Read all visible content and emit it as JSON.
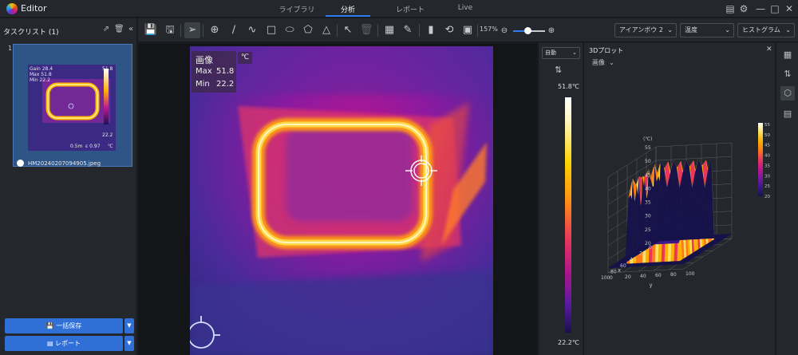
{
  "app": {
    "title": "Editor"
  },
  "nav": {
    "tabs": [
      {
        "label": "ライブラリ"
      },
      {
        "label": "分析"
      },
      {
        "label": "レポート"
      },
      {
        "label": "Live"
      }
    ],
    "active": "分析"
  },
  "tasklist": {
    "title": "タスクリスト (1)",
    "items": [
      {
        "index": "1",
        "filename": "HM20240207094905.jpeg",
        "thumb_gain": "Gain 28.4",
        "thumb_max": "Max 51.8",
        "thumb_min": "Min 22.2",
        "thumb_dist": "0.5m",
        "thumb_eps": "ε 0.97",
        "thumb_scale_max": "51.8",
        "thumb_scale_min": "22.2",
        "thumb_unit": "℃"
      }
    ],
    "save_all_label": "一括保存",
    "report_label": "レポート"
  },
  "toolbar": {
    "zoom_level": "157%"
  },
  "selectors": {
    "palette": "アイアンボウ 2",
    "measure": "温度",
    "view": "ヒストグラム"
  },
  "image": {
    "info_title": "画像",
    "max_label": "Max",
    "max_value": "51.8",
    "min_label": "Min",
    "min_value": "22.2",
    "unit": "℃"
  },
  "scale": {
    "mode": "自動",
    "max": "51.8℃",
    "min": "22.2℃"
  },
  "plot3d": {
    "title": "3Dプロット",
    "subject": "画像",
    "z_unit": "(℃)",
    "z_ticks": [
      "55",
      "50",
      "45",
      "40",
      "35",
      "30",
      "25",
      "20"
    ],
    "x_ticks": [
      "0",
      "20",
      "40",
      "60",
      "80",
      "100"
    ],
    "y_ticks": [
      "0",
      "20",
      "40",
      "60",
      "80",
      "100"
    ],
    "x_label": "x",
    "y_label": "y",
    "colorbar_ticks": [
      "55",
      "50",
      "45",
      "40",
      "35",
      "30",
      "25",
      "20"
    ]
  },
  "colors": {
    "accent": "#2f7cf0",
    "button": "#2f6fd6"
  },
  "icons": [
    "app-logo-icon",
    "document-icon",
    "gear-icon",
    "minimize-icon",
    "maximize-icon",
    "close-icon",
    "export-icon",
    "trash-icon",
    "collapse-icon",
    "save-icon",
    "save-as-icon",
    "pointer-icon",
    "spot-icon",
    "line-icon",
    "polyline-icon",
    "rectangle-icon",
    "ellipse-icon",
    "polygon-icon",
    "triangle-icon",
    "select-icon",
    "delete-icon",
    "image-icon",
    "edit-icon",
    "histogram-icon",
    "rotate-icon",
    "fit-icon",
    "zoom-out-icon",
    "zoom-in-icon",
    "image-panel-icon",
    "adjust-icon",
    "3d-icon",
    "report-icon"
  ]
}
